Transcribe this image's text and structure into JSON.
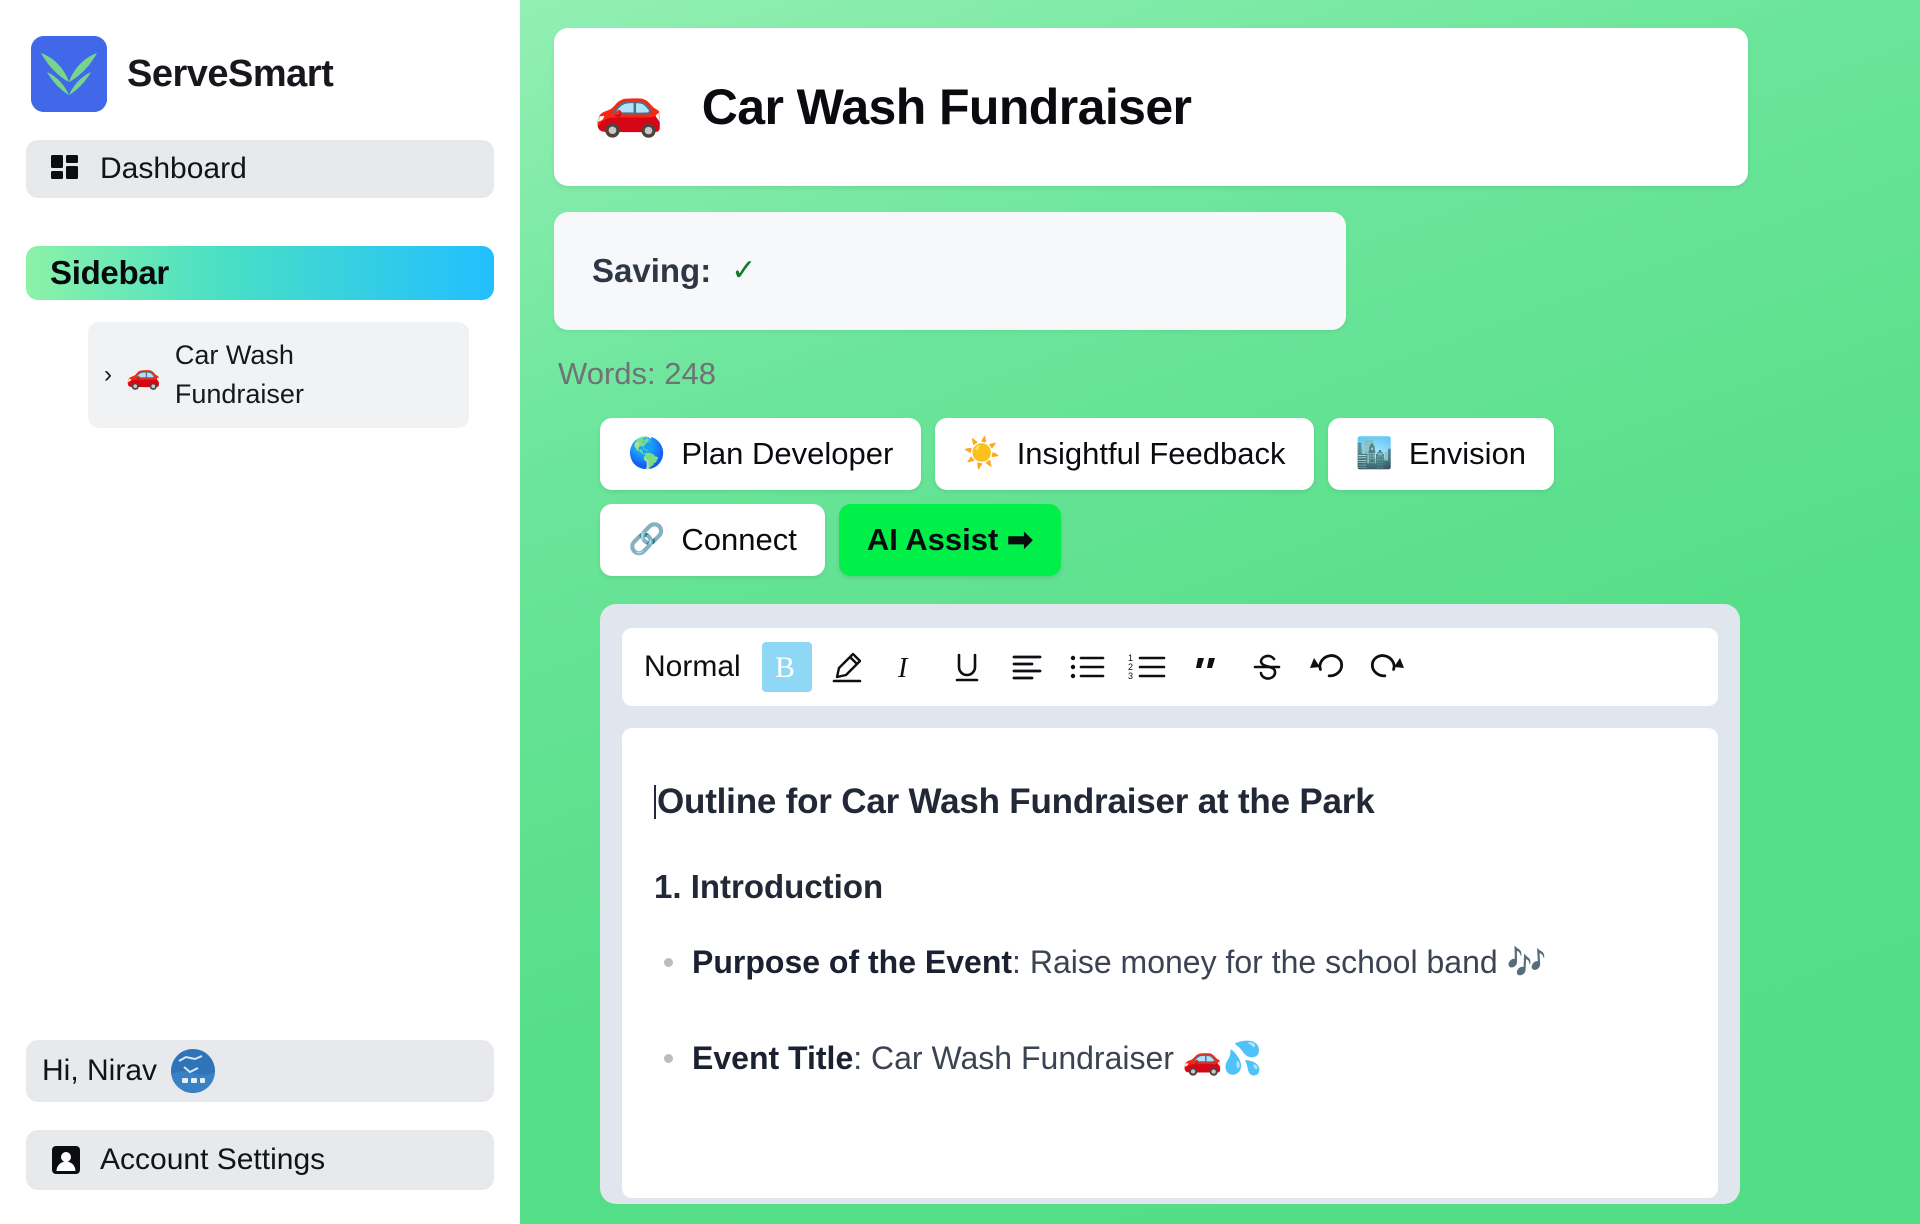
{
  "brand": {
    "name": "ServeSmart",
    "logo_icon": "leaf-wings-logo",
    "logo_bg": "#4068E8",
    "logo_fg": "#76D48D"
  },
  "sidebar": {
    "nav": [
      {
        "label": "Dashboard",
        "icon": "dashboard-grid-icon"
      }
    ],
    "section": {
      "title": "Sidebar",
      "gradient_from": "#8CF2A7",
      "gradient_to": "#22BFFF"
    },
    "tree": [
      {
        "chevron": "›",
        "emoji": "🚗",
        "label": "Car Wash Fundraiser"
      }
    ],
    "user": {
      "greeting": "Hi, Nirav",
      "avatar_icon": "user-avatar"
    },
    "account": {
      "label": "Account Settings",
      "icon": "person-card-icon"
    }
  },
  "header": {
    "emoji": "🚗",
    "title": "Car Wash Fundraiser"
  },
  "status": {
    "saving_label": "Saving:",
    "saving_check": "✓",
    "check_color": "#127a2e",
    "word_count": "Words: 248"
  },
  "actions": [
    {
      "label": "Plan Developer",
      "emoji": "🌎",
      "primary": false
    },
    {
      "label": "Insightful Feedback",
      "emoji": "☀️",
      "primary": false
    },
    {
      "label": "Envision",
      "emoji": "🏙️",
      "primary": false
    },
    {
      "label": "Connect",
      "emoji": "🔗",
      "primary": false
    },
    {
      "label": "AI Assist ➡",
      "emoji": "",
      "primary": true,
      "color": "#00EF48"
    }
  ],
  "toolbar": {
    "style_select": "Normal",
    "buttons": [
      {
        "name": "bold",
        "glyph": "B",
        "active": true
      },
      {
        "name": "highlighter-pen",
        "glyph": "",
        "active": false
      },
      {
        "name": "italic",
        "glyph": "I",
        "active": false
      },
      {
        "name": "underline",
        "glyph": "U",
        "active": false
      },
      {
        "name": "align-left",
        "glyph": "",
        "active": false
      },
      {
        "name": "bullet-list",
        "glyph": "",
        "active": false
      },
      {
        "name": "numbered-list",
        "glyph": "",
        "active": false
      },
      {
        "name": "blockquote",
        "glyph": "”",
        "active": false
      },
      {
        "name": "strikethrough",
        "glyph": "S",
        "active": false
      },
      {
        "name": "undo",
        "glyph": "",
        "active": false
      },
      {
        "name": "redo",
        "glyph": "",
        "active": false
      }
    ]
  },
  "document": {
    "title": "Outline for Car Wash Fundraiser at the Park",
    "section_heading": "1. Introduction",
    "bullets": [
      {
        "term": "Purpose of the Event",
        "sep": ": ",
        "text": "Raise money for the school band 🎶"
      },
      {
        "term": "Event Title",
        "sep": ": ",
        "text": "Car Wash Fundraiser 🚗💦"
      }
    ]
  }
}
